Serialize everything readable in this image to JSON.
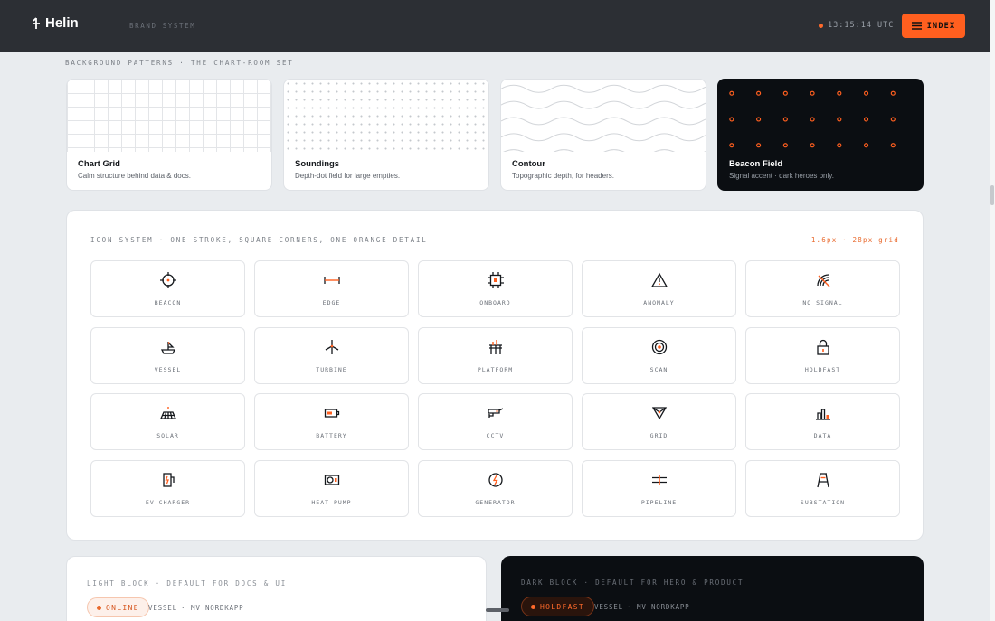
{
  "header": {
    "logo": "Helin",
    "brand_system": "BRAND SYSTEM",
    "clock": "13:15:14 UTC",
    "index_label": "INDEX"
  },
  "patterns": {
    "section_label": "BACKGROUND PATTERNS · THE CHART-ROOM SET",
    "cards": [
      {
        "title": "Chart Grid",
        "sub": "Calm structure behind data & docs."
      },
      {
        "title": "Soundings",
        "sub": "Depth-dot field for large empties."
      },
      {
        "title": "Contour",
        "sub": "Topographic depth, for headers."
      },
      {
        "title": "Beacon Field",
        "sub": "Signal accent · dark heroes only."
      }
    ]
  },
  "icon_system": {
    "title": "ICON SYSTEM · ONE STROKE, SQUARE CORNERS, ONE ORANGE DETAIL",
    "spec": "1.6px · 28px grid",
    "icons": [
      {
        "label": "BEACON",
        "icon": "beacon-icon"
      },
      {
        "label": "EDGE",
        "icon": "edge-icon"
      },
      {
        "label": "ONBOARD",
        "icon": "onboard-icon"
      },
      {
        "label": "ANOMALY",
        "icon": "anomaly-icon"
      },
      {
        "label": "NO SIGNAL",
        "icon": "no-signal-icon"
      },
      {
        "label": "VESSEL",
        "icon": "vessel-icon"
      },
      {
        "label": "TURBINE",
        "icon": "turbine-icon"
      },
      {
        "label": "PLATFORM",
        "icon": "platform-icon"
      },
      {
        "label": "SCAN",
        "icon": "scan-icon"
      },
      {
        "label": "HOLDFAST",
        "icon": "holdfast-icon"
      },
      {
        "label": "SOLAR",
        "icon": "solar-icon"
      },
      {
        "label": "BATTERY",
        "icon": "battery-icon"
      },
      {
        "label": "CCTV",
        "icon": "cctv-icon"
      },
      {
        "label": "GRID",
        "icon": "grid-icon"
      },
      {
        "label": "DATA",
        "icon": "data-icon"
      },
      {
        "label": "EV CHARGER",
        "icon": "ev-charger-icon"
      },
      {
        "label": "HEAT PUMP",
        "icon": "heat-pump-icon"
      },
      {
        "label": "GENERATOR",
        "icon": "generator-icon"
      },
      {
        "label": "PIPELINE",
        "icon": "pipeline-icon"
      },
      {
        "label": "SUBSTATION",
        "icon": "substation-icon"
      }
    ]
  },
  "light_block": {
    "title": "LIGHT BLOCK · DEFAULT FOR DOCS & UI",
    "pill": "ONLINE",
    "meta_a": "VESSEL",
    "meta_sep": "·",
    "meta_b": "MV NORDKAPP"
  },
  "dark_block": {
    "title": "DARK BLOCK · DEFAULT FOR HERO & PRODUCT",
    "pill": "HOLDFAST",
    "meta_a": "VESSEL",
    "meta_sep": "·",
    "meta_b": "MV NORDKAPP"
  },
  "colors": {
    "accent": "#ff5f1f",
    "dark": "#0b0e12",
    "header": "#2c2f34"
  }
}
